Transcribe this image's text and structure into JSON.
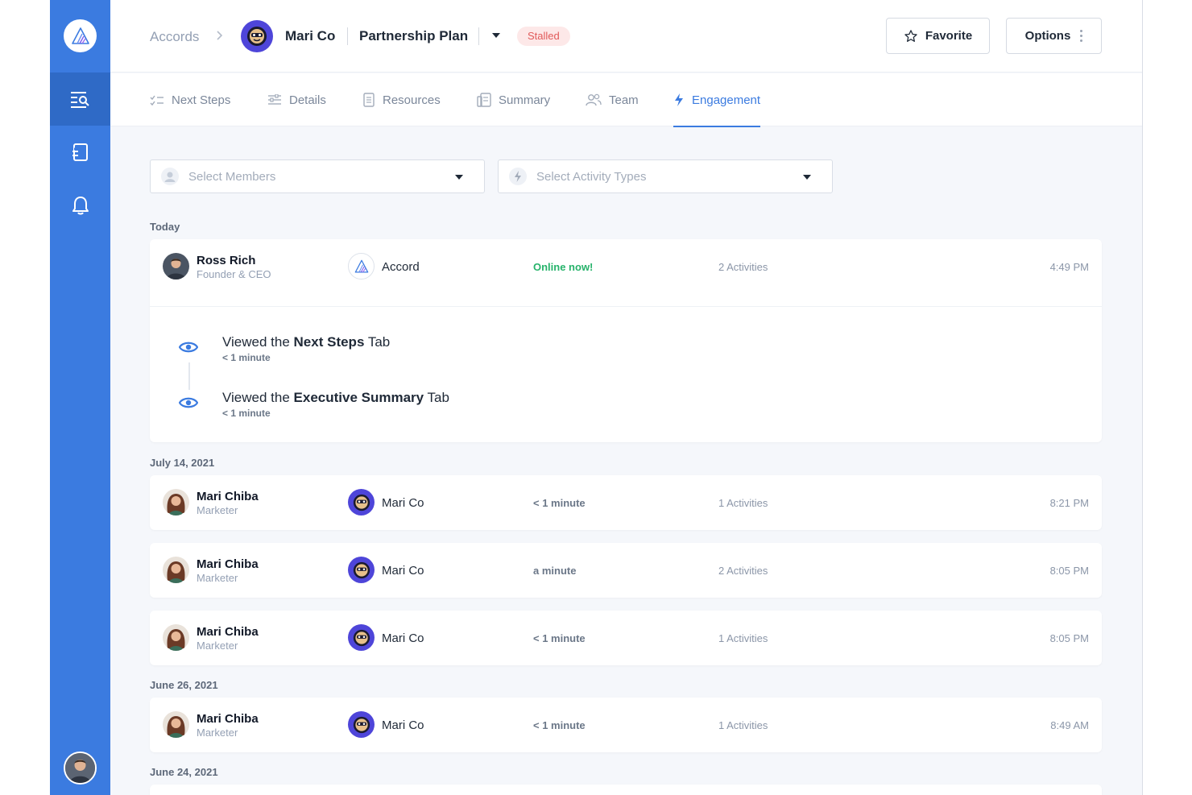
{
  "breadcrumb": {
    "root": "Accords",
    "company": "Mari Co",
    "plan": "Partnership Plan",
    "status": "Stalled"
  },
  "header": {
    "favorite_label": "Favorite",
    "options_label": "Options"
  },
  "tabs": [
    {
      "label": "Next Steps",
      "icon": "checklist-icon",
      "active": false
    },
    {
      "label": "Details",
      "icon": "sliders-icon",
      "active": false
    },
    {
      "label": "Resources",
      "icon": "document-icon",
      "active": false
    },
    {
      "label": "Summary",
      "icon": "summary-icon",
      "active": false
    },
    {
      "label": "Team",
      "icon": "team-icon",
      "active": false
    },
    {
      "label": "Engagement",
      "icon": "bolt-icon",
      "active": true
    }
  ],
  "filters": {
    "members_placeholder": "Select Members",
    "activity_placeholder": "Select Activity Types"
  },
  "groups": [
    {
      "date": "Today",
      "entries": [
        {
          "name": "Ross Rich",
          "role": "Founder & CEO",
          "company": "Accord",
          "duration": "Online now!",
          "activities": "2 Activities",
          "time": "4:49 PM",
          "expanded": true,
          "events": [
            {
              "prefix": "Viewed the ",
              "bold": "Next Steps",
              "suffix": " Tab",
              "duration": "< 1 minute"
            },
            {
              "prefix": "Viewed the ",
              "bold": "Executive Summary",
              "suffix": " Tab",
              "duration": "< 1 minute"
            }
          ]
        }
      ]
    },
    {
      "date": "July 14, 2021",
      "entries": [
        {
          "name": "Mari Chiba",
          "role": "Marketer",
          "company": "Mari Co",
          "duration": "< 1 minute",
          "activities": "1 Activities",
          "time": "8:21 PM"
        },
        {
          "name": "Mari Chiba",
          "role": "Marketer",
          "company": "Mari Co",
          "duration": "a minute",
          "activities": "2 Activities",
          "time": "8:05 PM"
        },
        {
          "name": "Mari Chiba",
          "role": "Marketer",
          "company": "Mari Co",
          "duration": "< 1 minute",
          "activities": "1 Activities",
          "time": "8:05 PM"
        }
      ]
    },
    {
      "date": "June 26, 2021",
      "entries": [
        {
          "name": "Mari Chiba",
          "role": "Marketer",
          "company": "Mari Co",
          "duration": "< 1 minute",
          "activities": "1 Activities",
          "time": "8:49 AM"
        }
      ]
    },
    {
      "date": "June 24, 2021",
      "entries": []
    }
  ],
  "colors": {
    "sidebar": "#3b7be0",
    "accent": "#3b7be0",
    "online": "#27b36b",
    "stalled_text": "#e15a5a",
    "stalled_bg": "#fde8e8"
  }
}
